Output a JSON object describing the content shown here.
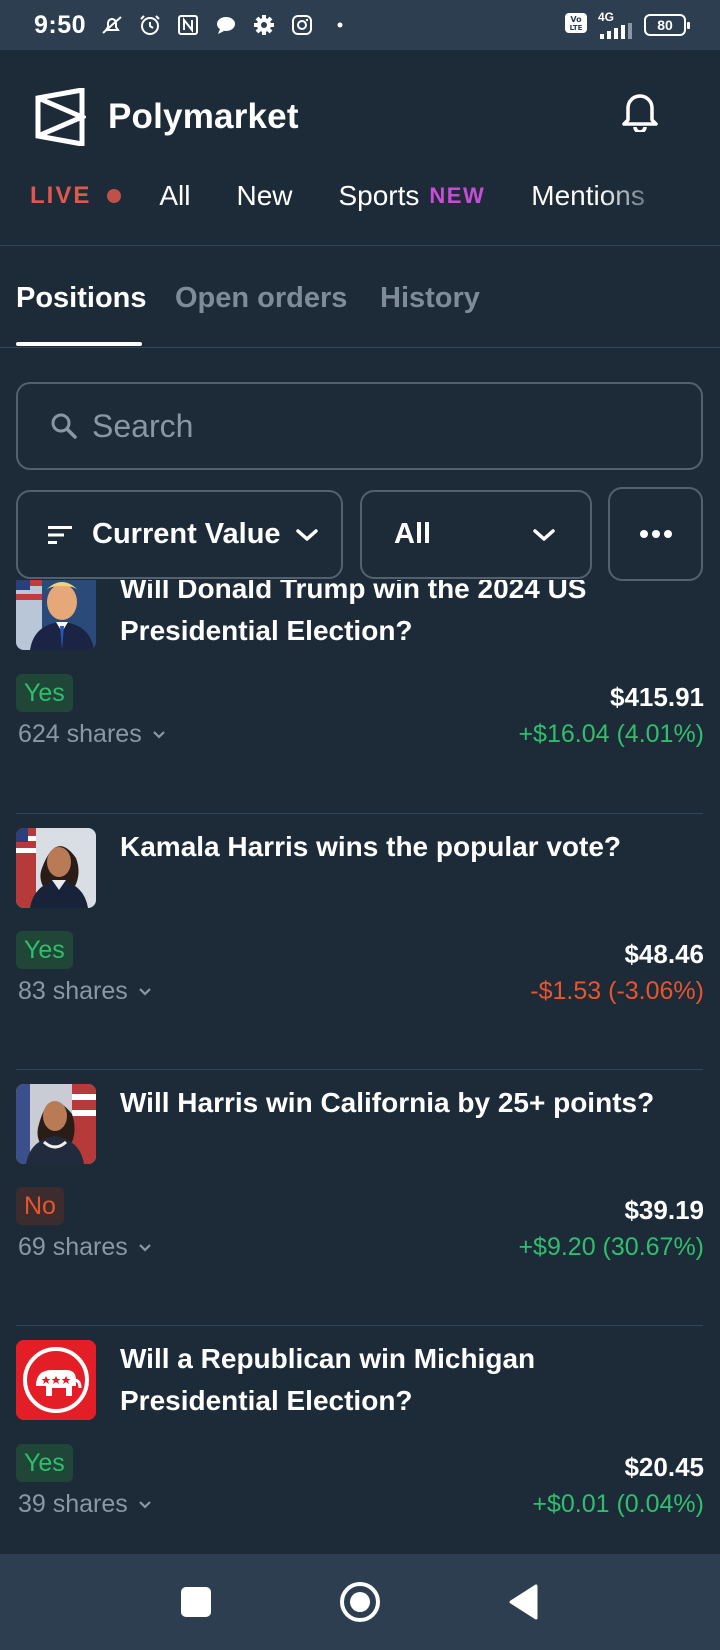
{
  "status_bar": {
    "time": "9:50",
    "network": "4G",
    "battery": "80",
    "icons": [
      "mute-icon",
      "alarm-icon",
      "nfc-icon",
      "chat-icon",
      "gear-icon",
      "instagram-icon",
      "dot-icon",
      "volte-icon",
      "signal-icon",
      "battery-icon"
    ]
  },
  "header": {
    "brand": "Polymarket",
    "live_label": "LIVE",
    "nav": [
      "All",
      "New",
      "Sports",
      "Mentions"
    ],
    "new_badge": "NEW"
  },
  "tabs": [
    "Positions",
    "Open orders",
    "History"
  ],
  "search": {
    "placeholder": "Search"
  },
  "filters": {
    "sort_label": "Current Value",
    "outcome_label": "All"
  },
  "positions": [
    {
      "title": "Will Donald Trump win the 2024 US Presidential Election?",
      "outcome": "Yes",
      "shares": "624 shares",
      "value": "$415.91",
      "pnl": "+$16.04 (4.01%)"
    },
    {
      "title": "Kamala Harris wins the popular vote?",
      "outcome": "Yes",
      "shares": "83 shares",
      "value": "$48.46",
      "pnl": "-$1.53 (-3.06%)"
    },
    {
      "title": "Will Harris win California by 25+ points?",
      "outcome": "No",
      "shares": "69 shares",
      "value": "$39.19",
      "pnl": "+$9.20 (30.67%)"
    },
    {
      "title": "Will a Republican win Michigan Presidential Election?",
      "outcome": "Yes",
      "shares": "39 shares",
      "value": "$20.45",
      "pnl": "+$0.01 (0.04%)"
    }
  ],
  "colors": {
    "background": "#1d2b39",
    "bar": "#2c3e50",
    "positive": "#2fbf6c",
    "negative": "#e8552b",
    "live": "#e2574c",
    "new_badge": "#c84dd6"
  }
}
